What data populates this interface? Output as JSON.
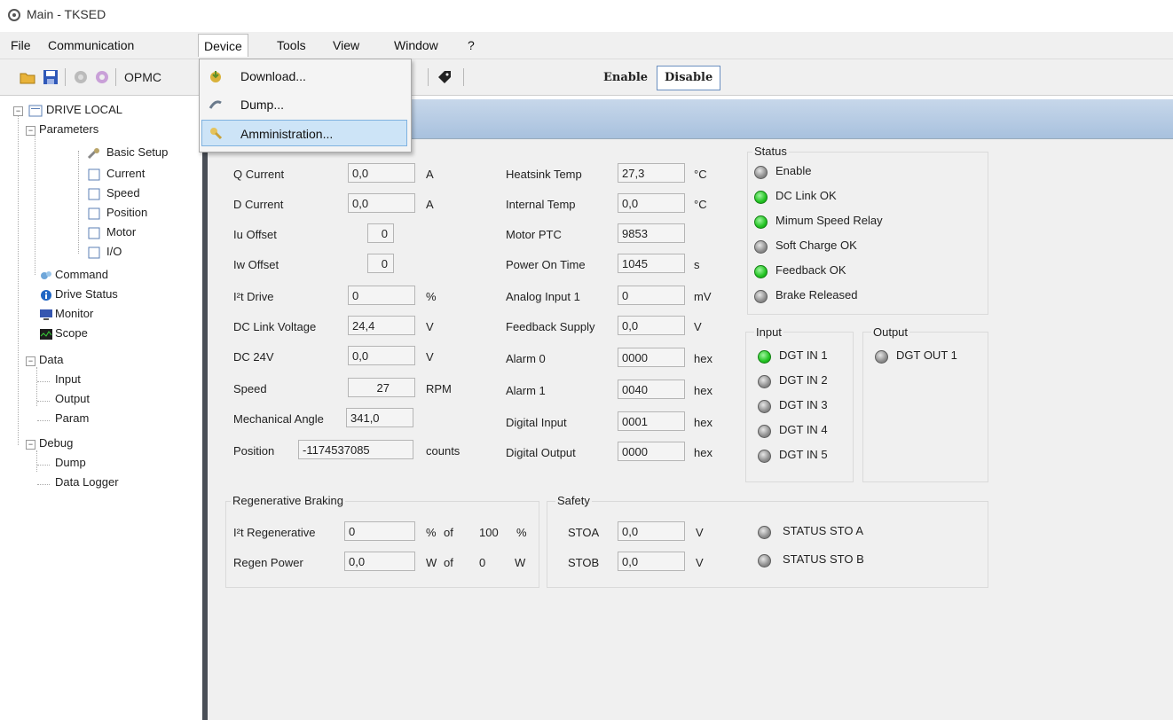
{
  "window": {
    "title": "Main - TKSED"
  },
  "menubar": {
    "items": [
      "File",
      "Communication",
      "Device",
      "Tools",
      "View",
      "Window",
      "?"
    ]
  },
  "device_menu": {
    "items": [
      "Download...",
      "Dump...",
      "Amministration..."
    ]
  },
  "toolbar": {
    "opmc_label": "OPMC",
    "enable_label": "Enable",
    "disable_label": "Disable"
  },
  "tree": {
    "root": "DRIVE LOCAL",
    "parameters": "Parameters",
    "parameters_children": [
      "Basic Setup",
      "Current",
      "Speed",
      "Position",
      "Motor",
      "I/O"
    ],
    "command": "Command",
    "drive_status": "Drive Status",
    "monitor": "Monitor",
    "scope": "Scope",
    "data": "Data",
    "data_children": [
      "Input",
      "Output",
      "Param"
    ],
    "debug": "Debug",
    "debug_children": [
      "Dump",
      "Data Logger"
    ]
  },
  "left_fields": [
    {
      "label": "Q Current",
      "value": "0,0",
      "unit": "A"
    },
    {
      "label": "D Current",
      "value": "0,0",
      "unit": "A"
    },
    {
      "label": "Iu Offset",
      "value": "0",
      "unit": ""
    },
    {
      "label": "Iw Offset",
      "value": "0",
      "unit": ""
    },
    {
      "label": "I²t Drive",
      "value": "0",
      "unit": "%"
    },
    {
      "label": "DC Link Voltage",
      "value": "24,4",
      "unit": "V"
    },
    {
      "label": "DC 24V",
      "value": "0,0",
      "unit": "V"
    },
    {
      "label": "Speed",
      "value": "27",
      "unit": "RPM"
    },
    {
      "label": "Mechanical Angle",
      "value": "341,0",
      "unit": ""
    },
    {
      "label": "Position",
      "value": "-1174537085",
      "unit": "counts"
    }
  ],
  "mid_fields": [
    {
      "label": "Heatsink Temp",
      "value": "27,3",
      "unit": "°C"
    },
    {
      "label": "Internal Temp",
      "value": "0,0",
      "unit": "°C"
    },
    {
      "label": "Motor PTC",
      "value": "9853",
      "unit": ""
    },
    {
      "label": "Power On Time",
      "value": "1045",
      "unit": "s"
    },
    {
      "label": "Analog Input 1",
      "value": "0",
      "unit": "mV"
    },
    {
      "label": "Feedback Supply",
      "value": "0,0",
      "unit": "V"
    },
    {
      "label": "Alarm 0",
      "value": "0000",
      "unit": "hex"
    },
    {
      "label": "Alarm 1",
      "value": "0040",
      "unit": "hex"
    },
    {
      "label": "Digital Input",
      "value": "0001",
      "unit": "hex"
    },
    {
      "label": "Digital Output",
      "value": "0000",
      "unit": "hex"
    }
  ],
  "status": {
    "title": "Status",
    "items": [
      {
        "label": "Enable",
        "state": "gray"
      },
      {
        "label": "DC Link OK",
        "state": "green"
      },
      {
        "label": "Mimum Speed Relay",
        "state": "green"
      },
      {
        "label": "Soft Charge OK",
        "state": "gray"
      },
      {
        "label": "Feedback OK",
        "state": "green"
      },
      {
        "label": "Brake Released",
        "state": "gray"
      }
    ]
  },
  "input": {
    "title": "Input",
    "items": [
      {
        "label": "DGT IN 1",
        "state": "green"
      },
      {
        "label": "DGT IN 2",
        "state": "gray"
      },
      {
        "label": "DGT IN 3",
        "state": "gray"
      },
      {
        "label": "DGT IN 4",
        "state": "gray"
      },
      {
        "label": "DGT IN 5",
        "state": "gray"
      }
    ]
  },
  "output": {
    "title": "Output",
    "items": [
      {
        "label": "DGT OUT 1",
        "state": "gray"
      }
    ]
  },
  "regen": {
    "title": "Regenerative Braking",
    "rows": [
      {
        "label": "I²t Regenerative",
        "value": "0",
        "unit1": "%",
        "of": "of",
        "max": "100",
        "unit2": "%"
      },
      {
        "label": "Regen Power",
        "value": "0,0",
        "unit1": "W",
        "of": "of",
        "max": "0",
        "unit2": "W"
      }
    ]
  },
  "safety": {
    "title": "Safety",
    "rows": [
      {
        "label": "STOA",
        "value": "0,0",
        "unit": "V",
        "status": "STATUS STO A",
        "state": "gray"
      },
      {
        "label": "STOB",
        "value": "0,0",
        "unit": "V",
        "status": "STATUS STO B",
        "state": "gray"
      }
    ]
  },
  "colors": {
    "led_green": "#22c322",
    "led_gray": "#8e8e8e",
    "header_blue": "#a8c1de",
    "menu_highlight": "#cde4f7"
  }
}
